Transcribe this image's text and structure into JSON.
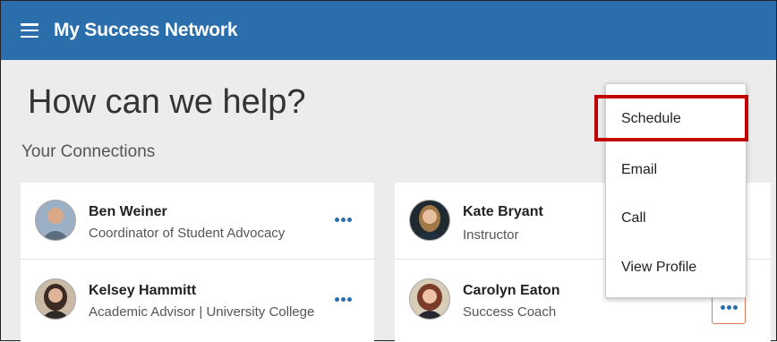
{
  "header": {
    "title": "My Success Network",
    "menu_icon": "hamburger-menu-icon",
    "bg_color": "#2a6fac"
  },
  "main": {
    "heading": "How can we help?",
    "subheading": "Your Connections"
  },
  "connections": [
    {
      "name": "Ben Weiner",
      "role": "Coordinator of Student Advocacy"
    },
    {
      "name": "Kelsey Hammitt",
      "role": "Academic Advisor | University College"
    },
    {
      "name": "Kate Bryant",
      "role": "Instructor"
    },
    {
      "name": "Carolyn Eaton",
      "role": "Success Coach"
    }
  ],
  "menu": {
    "items": [
      "Schedule",
      "Email",
      "Call",
      "View Profile"
    ],
    "highlighted": "Schedule",
    "highlight_color": "#c00000"
  }
}
